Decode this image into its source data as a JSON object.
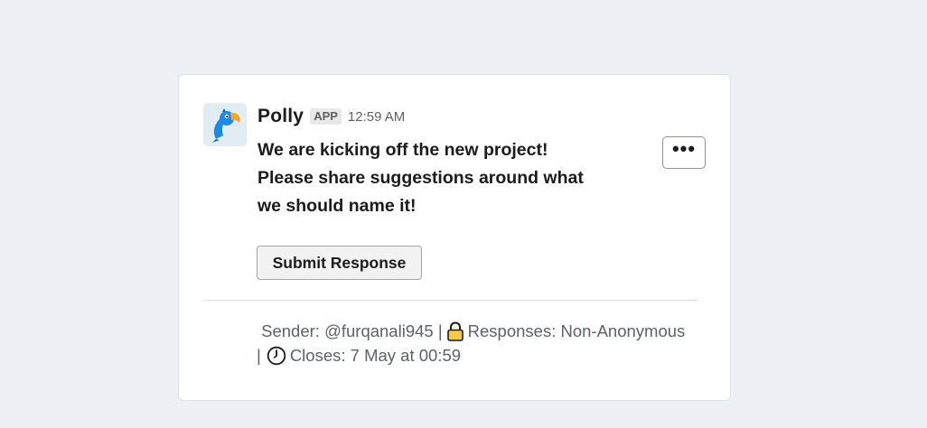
{
  "app": {
    "name": "Polly",
    "badge": "APP",
    "time": "12:59 AM"
  },
  "message": {
    "lines": [
      "We are kicking off the new project!",
      "Please share suggestions around what",
      "we should name it!"
    ]
  },
  "actions": {
    "more_label": "•••",
    "submit_label": "Submit Response"
  },
  "footer": {
    "sender_text": "Sender: @furqanali945 |",
    "responses_text": "Responses: Non-Anonymous",
    "separator": "|",
    "closes_text": "Closes: 7 May at 00:59",
    "icons": [
      "padlock-icon",
      "clock-icon"
    ]
  },
  "colors": {
    "background": "#edf1f5",
    "card": "#ffffff",
    "parrot_blue": "#1e88e5",
    "parrot_orange": "#f5a623",
    "lock_yellow": "#f7c948"
  }
}
